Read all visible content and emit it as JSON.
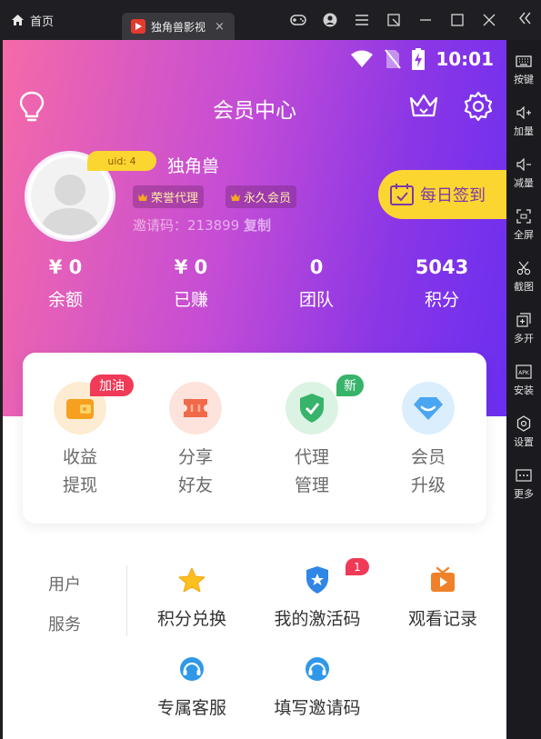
{
  "window": {
    "home_tab": "首页",
    "active_tab": "独角兽影视",
    "tab_close": "×"
  },
  "sidebar": {
    "items": [
      {
        "label": "按键",
        "icon": "keyboard-icon"
      },
      {
        "label": "加量",
        "icon": "volume-up-icon"
      },
      {
        "label": "减量",
        "icon": "volume-down-icon"
      },
      {
        "label": "全屏",
        "icon": "fullscreen-icon"
      },
      {
        "label": "截图",
        "icon": "scissors-icon"
      },
      {
        "label": "多开",
        "icon": "multi-instance-icon"
      },
      {
        "label": "安装",
        "icon": "apk-icon"
      },
      {
        "label": "设置",
        "icon": "settings-icon"
      },
      {
        "label": "更多",
        "icon": "more-icon"
      }
    ]
  },
  "status": {
    "time": "10:01"
  },
  "header": {
    "title": "会员中心"
  },
  "profile": {
    "uid": "uid: 4",
    "username": "独角兽",
    "badges": [
      "荣誉代理",
      "永久会员"
    ],
    "invite_label": "邀请码：213899",
    "invite_copy": "复制",
    "checkin_label": "每日签到"
  },
  "stats": [
    {
      "value": "¥ 0",
      "label": "余额"
    },
    {
      "value": "¥ 0",
      "label": "已赚"
    },
    {
      "value": "0",
      "label": "团队"
    },
    {
      "value": "5043",
      "label": "积分"
    }
  ],
  "actions": [
    {
      "line1": "收益",
      "line2": "提现",
      "badge": "加油"
    },
    {
      "line1": "分享",
      "line2": "好友",
      "badge": ""
    },
    {
      "line1": "代理",
      "line2": "管理",
      "badge": "新"
    },
    {
      "line1": "会员",
      "line2": "升级",
      "badge": ""
    }
  ],
  "services": {
    "title_line1": "用户",
    "title_line2": "服务",
    "items": [
      {
        "label": "积分兑换"
      },
      {
        "label": "我的激活码",
        "badge": "1"
      },
      {
        "label": "观看记录"
      },
      {
        "label": "专属客服"
      },
      {
        "label": "填写邀请码"
      }
    ]
  },
  "colors": {
    "gradient_start": "#f56aa8",
    "gradient_end": "#6a2ef0",
    "accent_yellow": "#fcd630",
    "badge_red": "#f03a58"
  }
}
